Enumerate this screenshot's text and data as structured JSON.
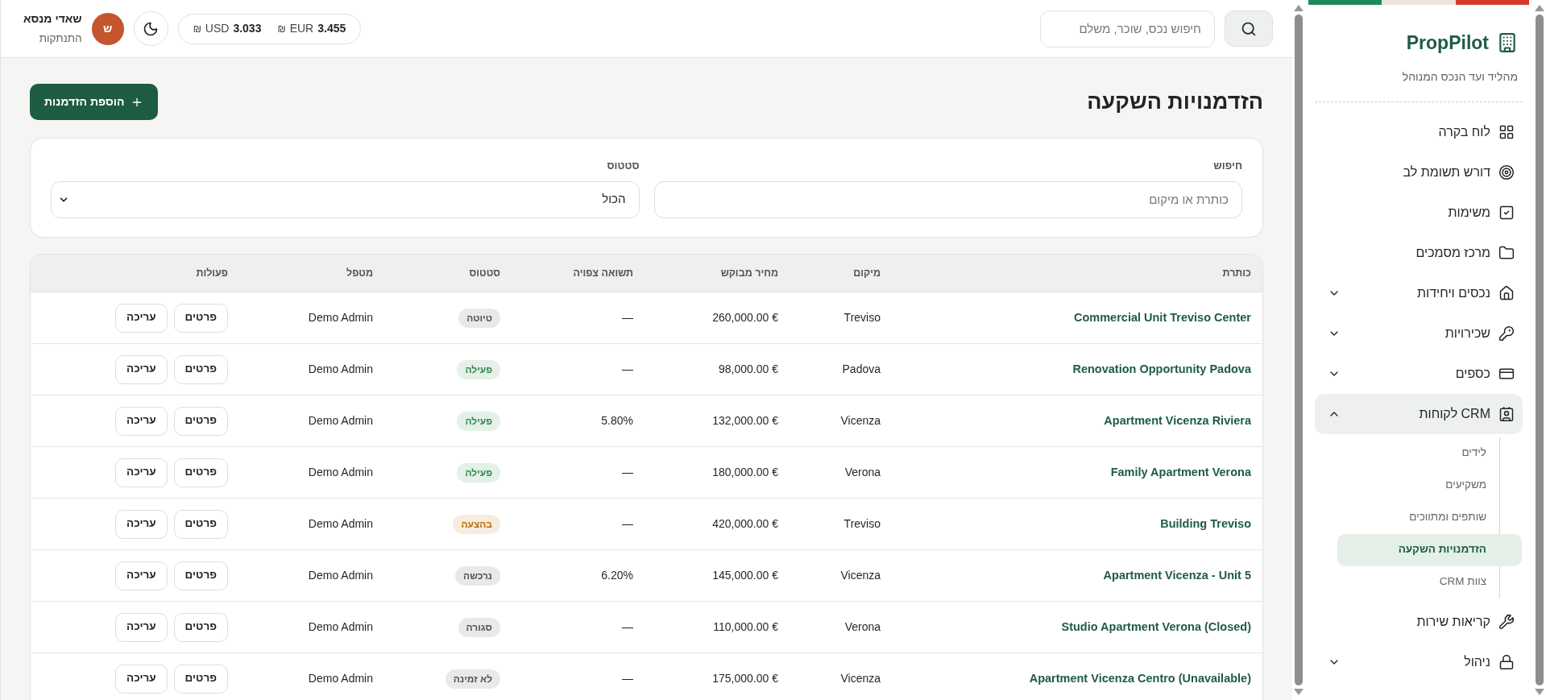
{
  "topbar": {
    "search": {
      "placeholder": "חיפוש נכס, שוכר, משלם"
    },
    "rates": [
      {
        "value": "3.455",
        "currency": "EUR",
        "symbol": "₪"
      },
      {
        "value": "3.033",
        "currency": "USD",
        "symbol": "₪"
      }
    ],
    "user": {
      "initial": "ש",
      "name": "שאדי מנסא",
      "logout": "התנתקות"
    }
  },
  "page": {
    "title": "הזדמנויות השקעה",
    "add_button": "הוספת הזדמנות"
  },
  "filters": {
    "search": {
      "label": "חיפוש",
      "placeholder": "כותרת או מיקום"
    },
    "status": {
      "label": "סטטוס",
      "value": "הכול"
    }
  },
  "table": {
    "columns": [
      "כותרת",
      "מיקום",
      "מחיר מבוקש",
      "תשואה צפויה",
      "סטטוס",
      "מטפל",
      "פעולות"
    ],
    "rows": [
      {
        "title": "Commercial Unit Treviso Center",
        "location": "Treviso",
        "price": "260,000.00 €",
        "yield": "—",
        "status": {
          "label": "טיוטה",
          "color": "#555555"
        },
        "handler": "Demo Admin",
        "actions": [
          "פרטים",
          "עריכה"
        ]
      },
      {
        "title": "Renovation Opportunity Padova",
        "location": "Padova",
        "price": "98,000.00 €",
        "yield": "—",
        "status": {
          "label": "פעילה",
          "color": "#2f8a4f"
        },
        "handler": "Demo Admin",
        "actions": [
          "פרטים",
          "עריכה"
        ]
      },
      {
        "title": "Apartment Vicenza Riviera",
        "location": "Vicenza",
        "price": "132,000.00 €",
        "yield": "5.80%",
        "status": {
          "label": "פעילה",
          "color": "#2f8a4f"
        },
        "handler": "Demo Admin",
        "actions": [
          "פרטים",
          "עריכה"
        ]
      },
      {
        "title": "Family Apartment Verona",
        "location": "Verona",
        "price": "180,000.00 €",
        "yield": "—",
        "status": {
          "label": "פעילה",
          "color": "#2f8a4f"
        },
        "handler": "Demo Admin",
        "actions": [
          "פרטים",
          "עריכה"
        ]
      },
      {
        "title": "Building Treviso",
        "location": "Treviso",
        "price": "420,000.00 €",
        "yield": "—",
        "status": {
          "label": "בהצעה",
          "color": "#b86e0c"
        },
        "handler": "Demo Admin",
        "actions": [
          "פרטים",
          "עריכה"
        ]
      },
      {
        "title": "Apartment Vicenza - Unit 5",
        "location": "Vicenza",
        "price": "145,000.00 €",
        "yield": "6.20%",
        "status": {
          "label": "נרכשה",
          "color": "#555555"
        },
        "handler": "Demo Admin",
        "actions": [
          "פרטים",
          "עריכה"
        ]
      },
      {
        "title": "Studio Apartment Verona (Closed)",
        "location": "Verona",
        "price": "110,000.00 €",
        "yield": "—",
        "status": {
          "label": "סגורה",
          "color": "#555555"
        },
        "handler": "Demo Admin",
        "actions": [
          "פרטים",
          "עריכה"
        ]
      },
      {
        "title": "Apartment Vicenza Centro (Unavailable)",
        "location": "Vicenza",
        "price": "175,000.00 €",
        "yield": "—",
        "status": {
          "label": "לא זמינה",
          "color": "#555555"
        },
        "handler": "Demo Admin",
        "actions": [
          "פרטים",
          "עריכה"
        ]
      }
    ]
  },
  "sidebar": {
    "brand": "PropPilot",
    "tagline": "מהליד ועד הנכס המנוהל",
    "items": [
      {
        "label": "לוח בקרה",
        "selected": false
      },
      {
        "label": "דורש תשומת לב",
        "selected": false
      },
      {
        "label": "משימות",
        "selected": false
      },
      {
        "label": "מרכז מסמכים",
        "selected": false
      },
      {
        "label": "נכסים ויחידות",
        "selected": false,
        "expanded": false
      },
      {
        "label": "שכירויות",
        "selected": false,
        "expanded": false
      },
      {
        "label": "כספים",
        "selected": false,
        "expanded": false
      },
      {
        "label": "CRM לקוחות",
        "selected": true,
        "expanded": true,
        "children": [
          {
            "label": "לידים",
            "selected": false
          },
          {
            "label": "משקיעים",
            "selected": false
          },
          {
            "label": "שותפים ומתווכים",
            "selected": false
          },
          {
            "label": "הזדמנויות השקעה",
            "selected": true
          },
          {
            "label": "צוות CRM",
            "selected": false
          }
        ]
      },
      {
        "label": "קריאות שירות",
        "selected": false
      },
      {
        "label": "ניהול",
        "selected": false,
        "expanded": false
      }
    ]
  }
}
